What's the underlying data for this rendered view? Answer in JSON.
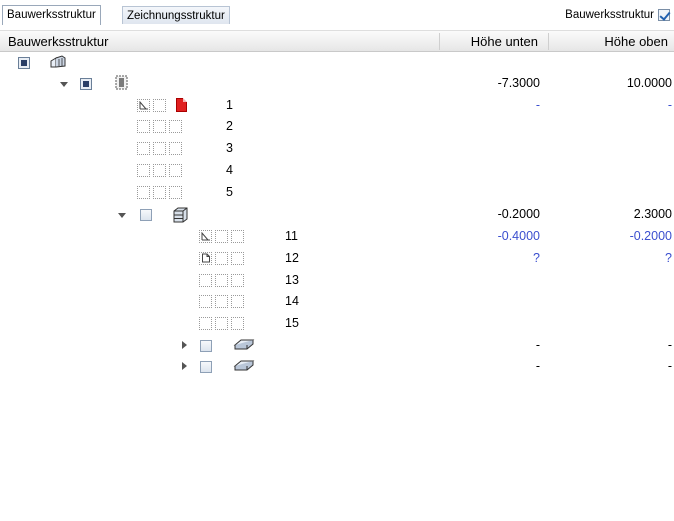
{
  "tabs": [
    {
      "label": "Bauwerksstruktur",
      "active": true
    },
    {
      "label": "Zeichnungsstruktur",
      "active": false
    }
  ],
  "toggle": {
    "label": "Bauwerksstruktur",
    "checked": true
  },
  "columns": {
    "name": "Bauwerksstruktur",
    "hoehe_unten": "Höhe unten",
    "hoehe_oben": "Höhe oben"
  },
  "rows": {
    "building": {
      "expanded": true
    },
    "level1": {
      "unten": "-7.3000",
      "oben": "10.0000",
      "expanded": true
    },
    "layers1": [
      {
        "label": "1",
        "unten": "-",
        "oben": "-"
      },
      {
        "label": "2"
      },
      {
        "label": "3"
      },
      {
        "label": "4"
      },
      {
        "label": "5"
      }
    ],
    "level2": {
      "unten": "-0.2000",
      "oben": "2.3000",
      "expanded": true
    },
    "layers2": [
      {
        "label": "11",
        "unten": "-0.4000",
        "oben": "-0.2000"
      },
      {
        "label": "12",
        "unten": "?",
        "oben": "?"
      },
      {
        "label": "13"
      },
      {
        "label": "14"
      },
      {
        "label": "15"
      }
    ],
    "slabs": [
      {
        "unten": "-",
        "oben": "-",
        "expanded": false
      },
      {
        "unten": "-",
        "oben": "-",
        "expanded": false
      }
    ]
  },
  "colors": {
    "blue_values": "#3b4fcf",
    "red_drawing": "#e02020"
  }
}
